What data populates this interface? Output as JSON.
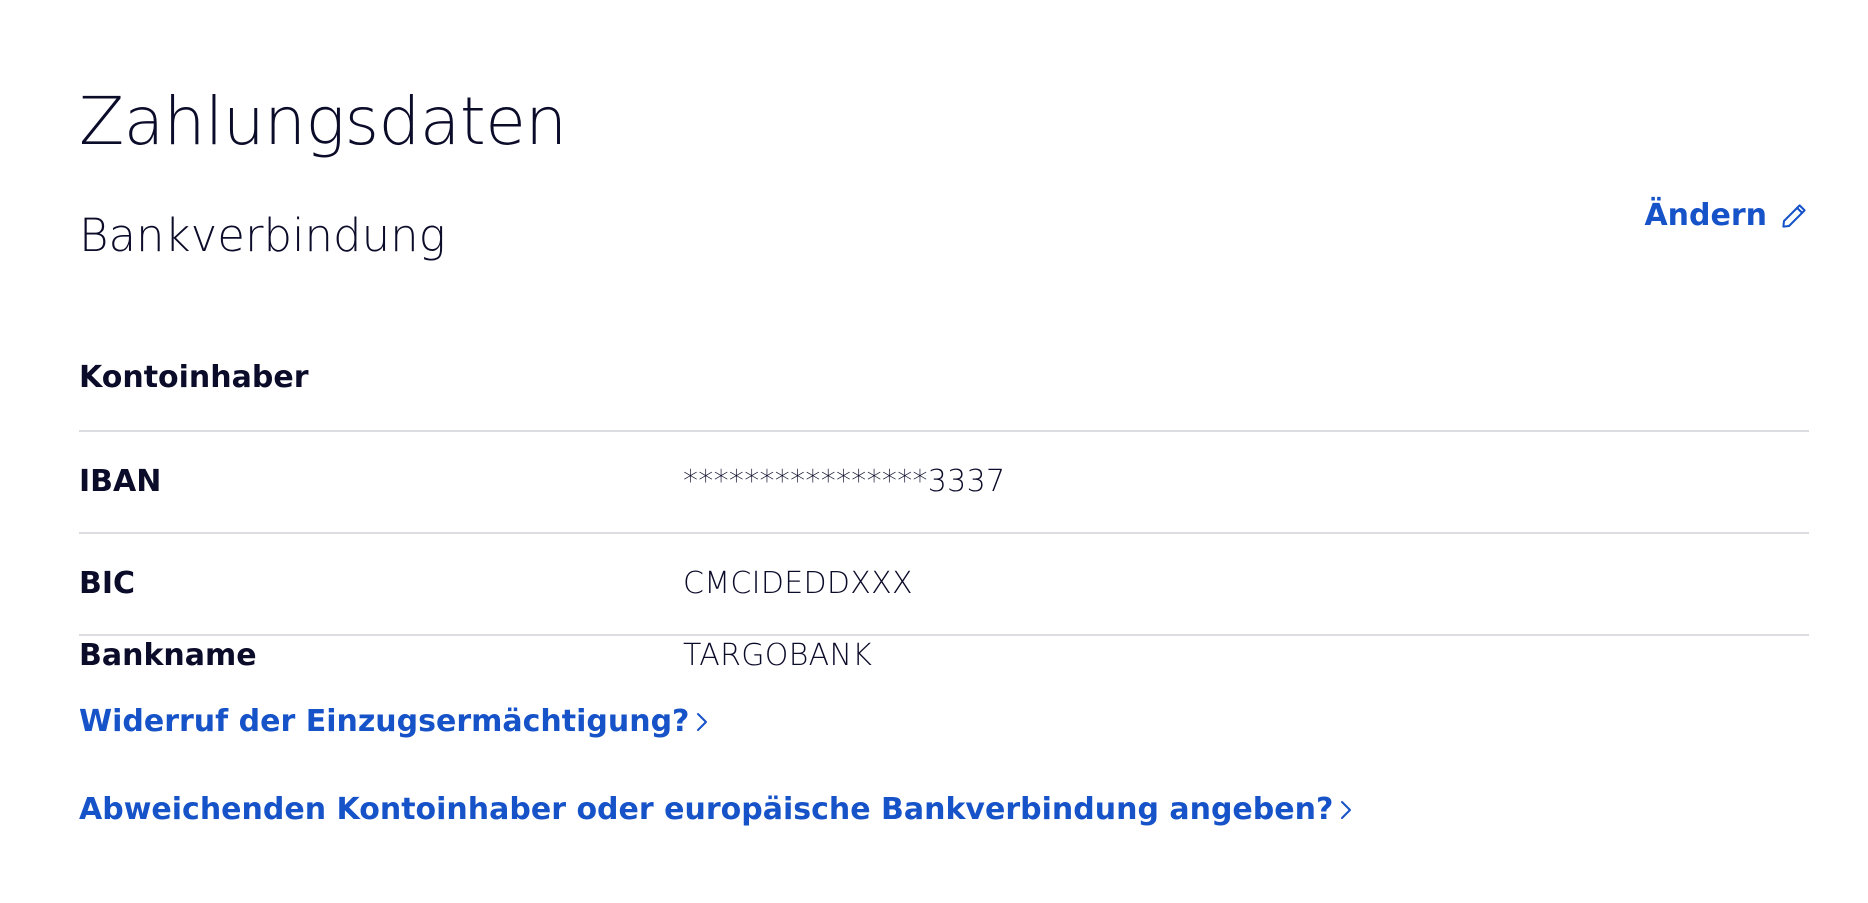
{
  "page": {
    "title": "Zahlungsdaten"
  },
  "bank_section": {
    "title": "Bankverbindung",
    "edit_label": "Ändern",
    "rows": [
      {
        "label": "Kontoinhaber",
        "value": ""
      },
      {
        "label": "IBAN",
        "value": "****************3337"
      },
      {
        "label": "BIC",
        "value": "CMCIDEDDXXX"
      },
      {
        "label": "Bankname",
        "value": "TARGOBANK"
      }
    ]
  },
  "links": {
    "revoke_label": "Widerruf der Einzugsermächtigung?",
    "other_account_label": "Abweichenden Kontoinhaber oder europäische Bankverbindung angeben?"
  },
  "icons": {
    "edit": "pencil-icon",
    "link_arrow": "chevron-right-icon"
  },
  "colors": {
    "text": "#0b0b2a",
    "link": "#1652c8",
    "divider": "#dcdde1",
    "background": "#ffffff"
  }
}
